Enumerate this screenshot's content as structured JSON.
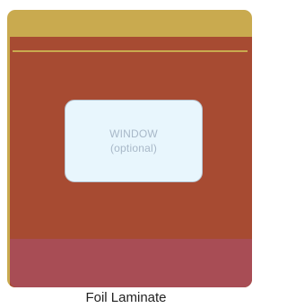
{
  "diagram": {
    "window": {
      "label": "WINDOW",
      "sublabel": "(optional)"
    },
    "caption": "Foil Laminate",
    "colors": {
      "top_band": "#c9aa4f",
      "body": "#a74b32",
      "bottom_gusset": "#a84d55",
      "window_fill": "#e8f6fd",
      "window_text": "#a8b8c8"
    }
  }
}
